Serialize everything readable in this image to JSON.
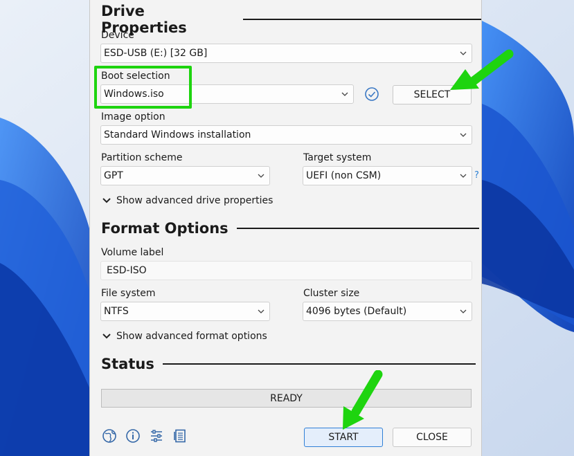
{
  "drive_properties": {
    "heading": "Drive Properties",
    "device": {
      "label": "Device",
      "value": "ESD-USB (E:) [32 GB]"
    },
    "boot_selection": {
      "label": "Boot selection",
      "value": "Windows.iso",
      "select_label": "SELECT"
    },
    "image_option": {
      "label": "Image option",
      "value": "Standard Windows installation"
    },
    "partition_scheme": {
      "label": "Partition scheme",
      "value": "GPT"
    },
    "target_system": {
      "label": "Target system",
      "value": "UEFI (non CSM)",
      "help": "?"
    },
    "advanced_toggle": "Show advanced drive properties"
  },
  "format_options": {
    "heading": "Format Options",
    "volume_label": {
      "label": "Volume label",
      "value": "ESD-ISO"
    },
    "file_system": {
      "label": "File system",
      "value": "NTFS"
    },
    "cluster_size": {
      "label": "Cluster size",
      "value": "4096 bytes (Default)"
    },
    "advanced_toggle": "Show advanced format options"
  },
  "status": {
    "heading": "Status",
    "text": "READY",
    "progress": 0
  },
  "footer": {
    "icons": [
      "globe-icon",
      "info-icon",
      "settings-sliders-icon",
      "log-icon"
    ],
    "start_label": "START",
    "close_label": "CLOSE"
  },
  "annotations": {
    "highlight_color": "#1ed40f"
  }
}
